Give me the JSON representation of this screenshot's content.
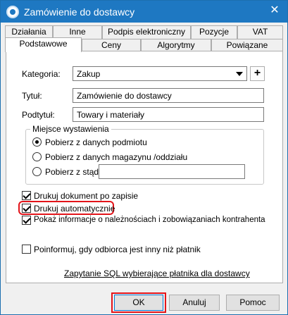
{
  "window": {
    "title": "Zamówienie do dostawcy"
  },
  "tabs": {
    "row1": [
      "Działania",
      "Inne",
      "Podpis elektroniczny",
      "Pozycje",
      "VAT"
    ],
    "row2": [
      "Podstawowe",
      "Ceny",
      "Algorytmy",
      "Powiązane"
    ],
    "active": "Podstawowe"
  },
  "form": {
    "category_label": "Kategoria:",
    "category_value": "Zakup",
    "title_label": "Tytuł:",
    "title_value": "Zamówienie do dostawcy",
    "subtitle_label": "Podtytuł:",
    "subtitle_value": "Towary i materiały"
  },
  "issue_place": {
    "group_title": "Miejsce wystawienia",
    "opt_subject": "Pobierz z danych podmiotu",
    "opt_warehouse": "Pobierz z danych magazynu /oddziału",
    "opt_from": "Pobierz z stąd:",
    "from_value": "",
    "selected": "opt_subject"
  },
  "options": {
    "print_after_save": {
      "label": "Drukuj dokument po zapisie",
      "checked": true
    },
    "auto_print": {
      "label": "Drukuj automatycznie",
      "checked": true
    },
    "show_receivables": {
      "label": "Pokaż informacje o należnościach i zobowiązaniach kontrahenta",
      "checked": true
    },
    "notify_payer": {
      "label": "Poinformuj, gdy odbiorca jest inny niż płatnik",
      "checked": false
    }
  },
  "sql_link": "Zapytanie SQL wybierające płatnika dla dostawcy",
  "buttons": {
    "ok": "OK",
    "cancel": "Anuluj",
    "help": "Pomoc"
  },
  "colors": {
    "titlebar": "#1e78c2",
    "highlight": "#e3141a"
  }
}
